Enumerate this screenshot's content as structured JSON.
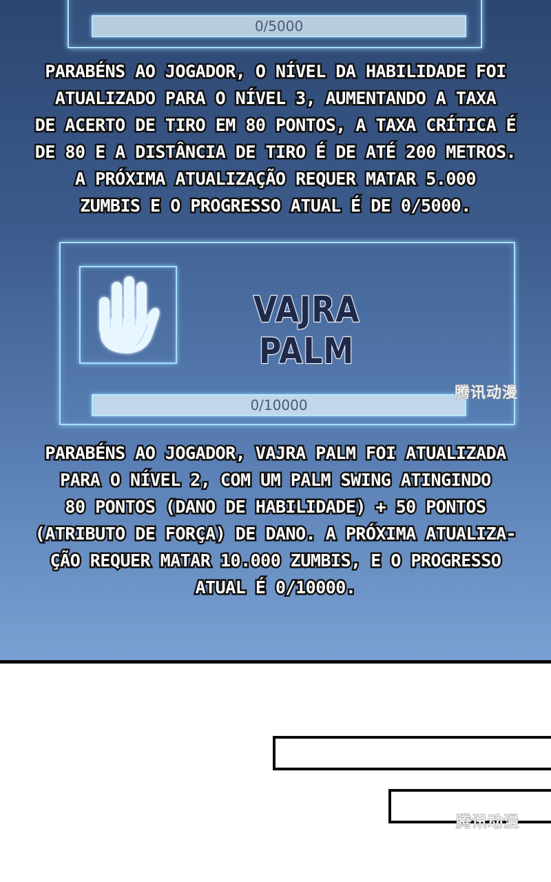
{
  "top_card": {
    "progress_text": "0/5000",
    "progress_fraction": 0
  },
  "narration_1": {
    "lines": [
      "PARABÉNS AO JOGADOR, O NÍVEL DA HABILIDADE FOI",
      "ATUALIZADO PARA O NÍVEL 3, AUMENTANDO A TAXA",
      "DE ACERTO DE TIRO EM 80 PONTOS, A TAXA CRÍTICA É",
      "DE 80 E A DISTÂNCIA DE TIRO É DE ATÉ 200 METROS.",
      "A PRÓXIMA ATUALIZAÇÃO REQUER MATAR 5.000",
      "ZUMBIS E O PROGRESSO ATUAL É DE 0/5000."
    ]
  },
  "vajra_card": {
    "icon": "raised-palm-icon",
    "skill_name": "VAJRA PALM",
    "progress_text": "0/10000",
    "progress_fraction": 0
  },
  "narration_2": {
    "lines": [
      "PARABÉNS AO JOGADOR, VAJRA PALM FOI ATUALIZADA",
      "PARA O NÍVEL 2, COM UM PALM SWING ATINGINDO",
      "80 PONTOS (DANO DE HABILIDADE) + 50 PONTOS",
      "(ATRIBUTO DE FORÇA) DE DANO. A PRÓXIMA ATUALIZA-",
      "ÇÃO REQUER MATAR 10.000 ZUMBIS, E O PROGRESSO",
      "ATUAL É 0/10000."
    ]
  },
  "watermark_text": "腾讯动漫",
  "colors": {
    "panel_top": "#2d4671",
    "panel_bottom": "#7aa1d3",
    "glow": "#a8e0ff",
    "skill_name": "#1f2a4a"
  }
}
